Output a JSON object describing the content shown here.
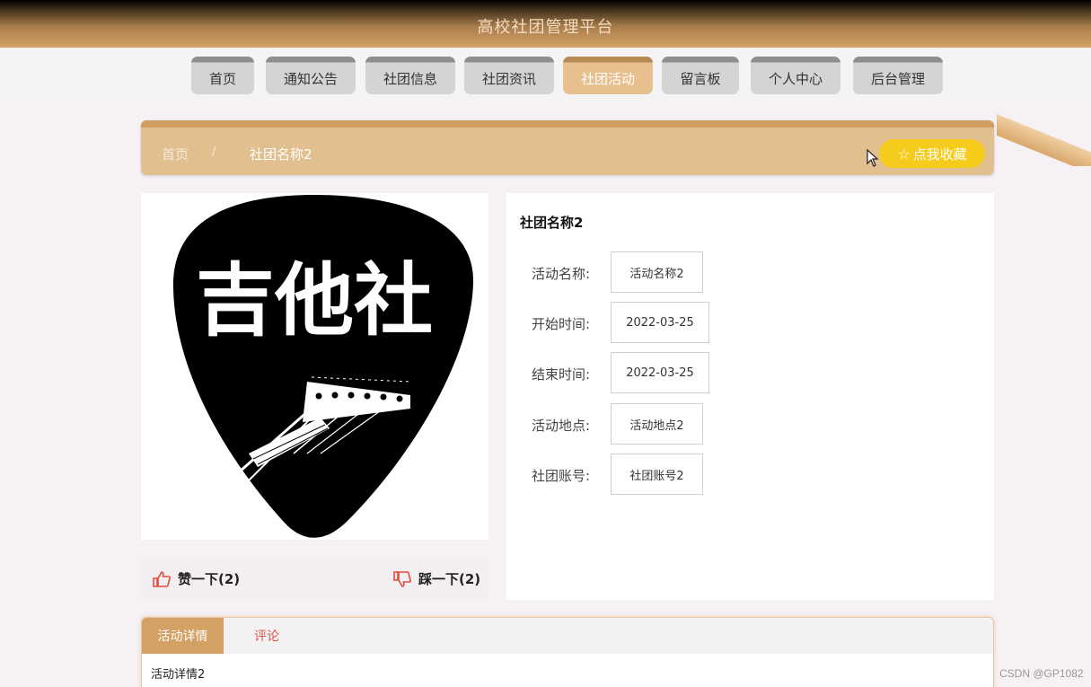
{
  "header": {
    "title": "高校社团管理平台"
  },
  "nav": {
    "items": [
      {
        "label": "首页"
      },
      {
        "label": "通知公告"
      },
      {
        "label": "社团信息"
      },
      {
        "label": "社团资讯"
      },
      {
        "label": "社团活动",
        "active": true
      },
      {
        "label": "留言板"
      },
      {
        "label": "个人中心"
      },
      {
        "label": "后台管理"
      }
    ]
  },
  "breadcrumb": {
    "home": "首页",
    "separator": "/",
    "current": "社团名称2"
  },
  "favorite": {
    "label": "点我收藏",
    "icon": "star-icon"
  },
  "image": {
    "logo_text": "吉他社",
    "icon": "guitar-pick-logo"
  },
  "likes": {
    "like_label": "赞一下(2)",
    "dislike_label": "踩一下(2)",
    "like_icon": "thumbs-up-icon",
    "dislike_icon": "thumbs-down-icon"
  },
  "info": {
    "title": "社团名称2",
    "rows": [
      {
        "label": "活动名称:",
        "value": "活动名称2"
      },
      {
        "label": "开始时间:",
        "value": "2022-03-25"
      },
      {
        "label": "结束时间:",
        "value": "2022-03-25"
      },
      {
        "label": "活动地点:",
        "value": "活动地点2"
      },
      {
        "label": "社团账号:",
        "value": "社团账号2"
      }
    ]
  },
  "tabs": {
    "items": [
      {
        "label": "活动详情",
        "active": true
      },
      {
        "label": "评论"
      }
    ],
    "content": "活动详情2"
  },
  "watermark": "CSDN @GP1082",
  "colors": {
    "accent": "#d4a165",
    "favorite": "#f5cc1c",
    "tab_inactive_text": "#e0564b"
  }
}
